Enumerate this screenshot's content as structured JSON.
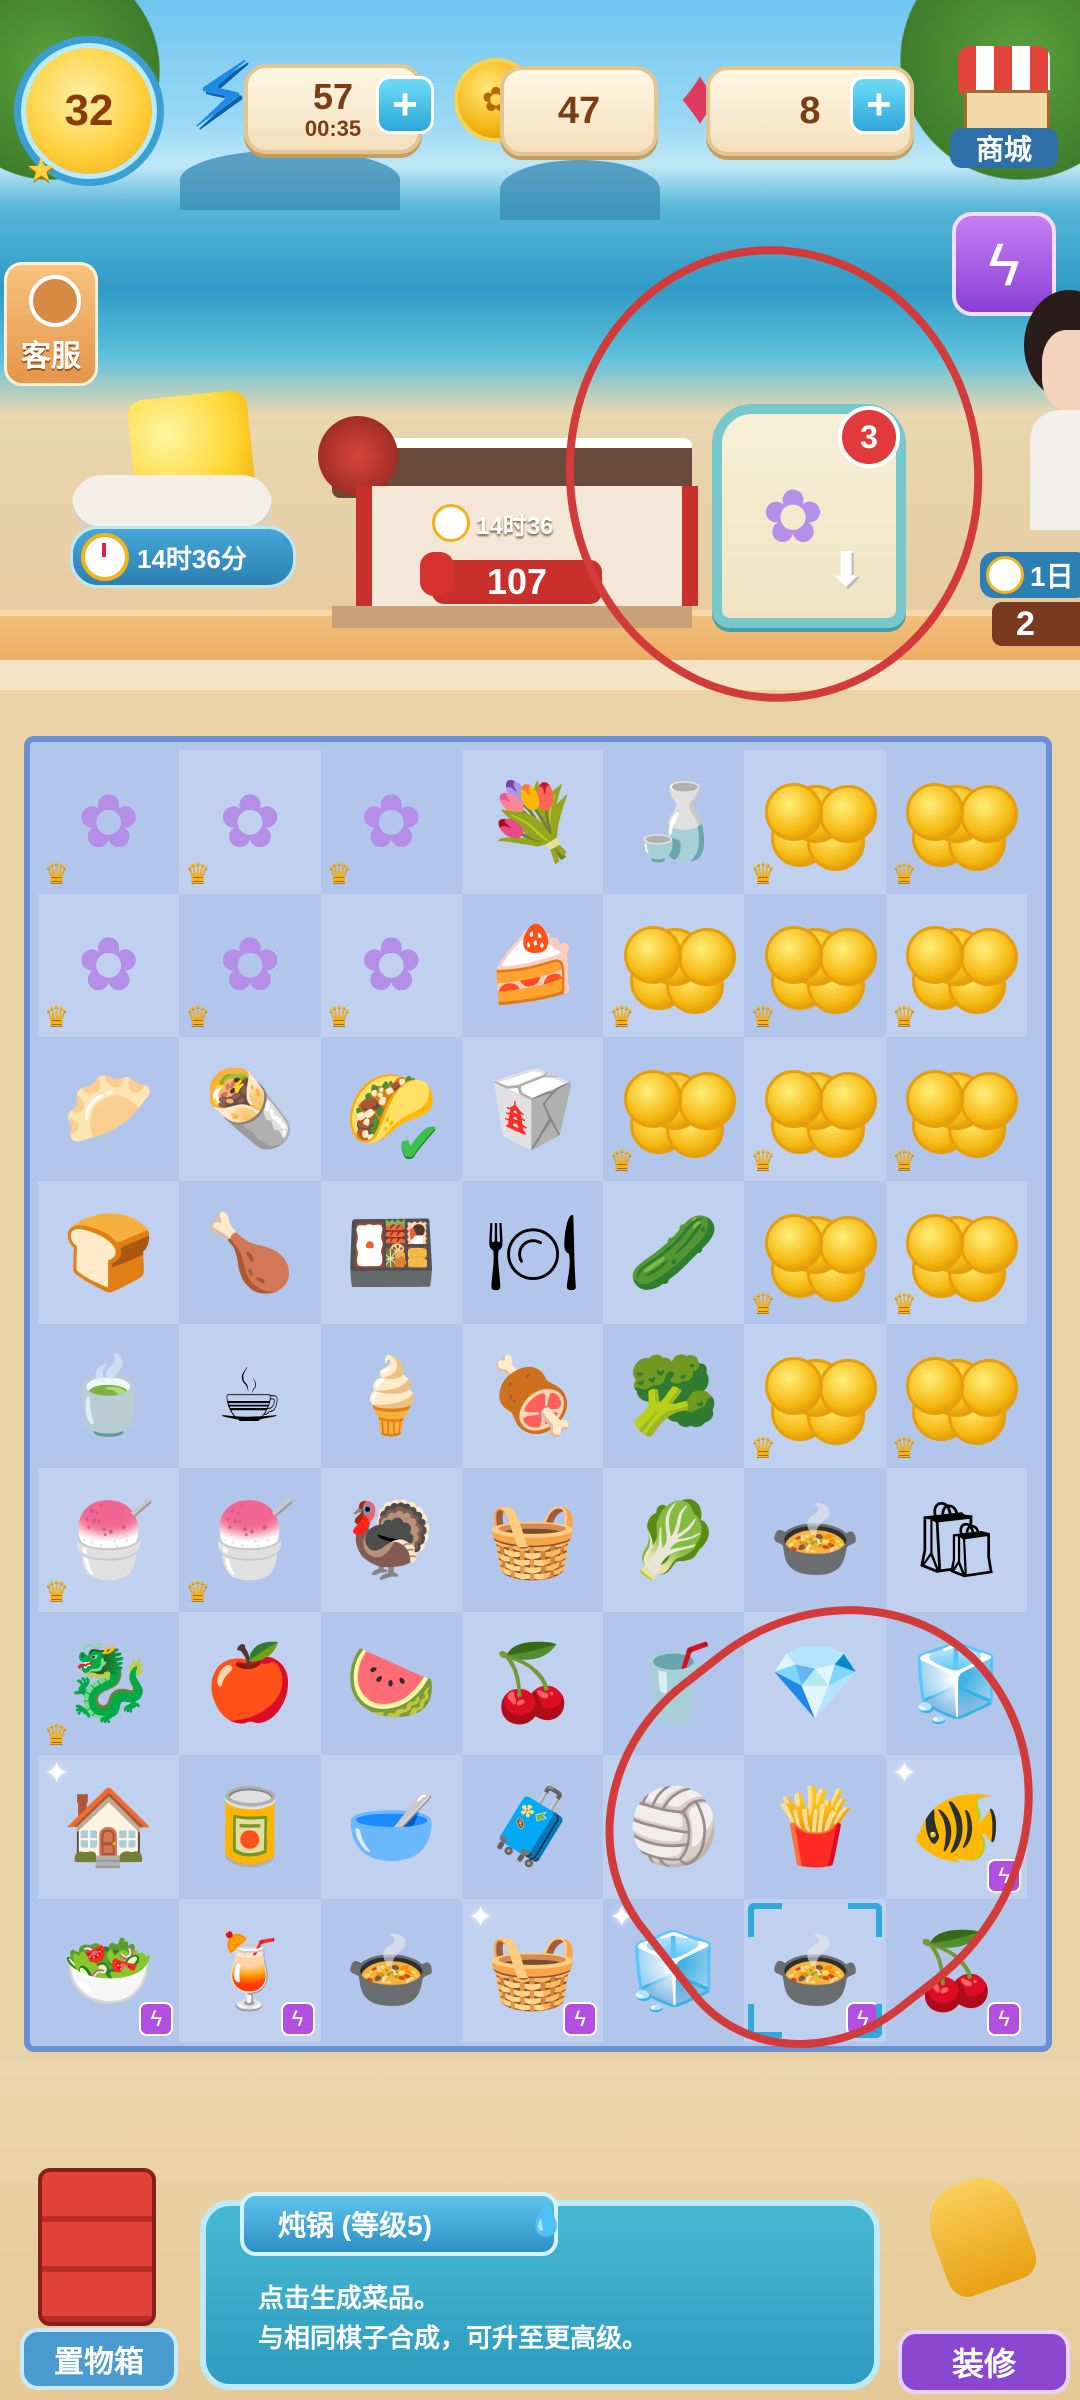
{
  "hud": {
    "level": "32",
    "energy": {
      "value": "57",
      "timer": "00:35"
    },
    "coins": {
      "value": "47"
    },
    "gems": {
      "value": "8"
    },
    "shop_label": "商城",
    "customer_service_label": "客服"
  },
  "buildings": {
    "cheese_stand_timer": "14时36分",
    "temple_timer": "14时36",
    "temple_count": "107",
    "flower_box_badge": "3",
    "right_stand_timer": "1日",
    "right_stand_count": "2"
  },
  "board": {
    "rows": [
      [
        "flower",
        "flower",
        "flower",
        "bouquet",
        "vase",
        "coins",
        "coins"
      ],
      [
        "flower",
        "flower",
        "flower",
        "cake",
        "coins",
        "coins",
        "coins"
      ],
      [
        "bun",
        "wrap",
        "taco",
        "takeout",
        "coins",
        "coins",
        "coins"
      ],
      [
        "bread",
        "duck",
        "bento",
        "tray",
        "cucumber",
        "coins",
        "coins"
      ],
      [
        "soup",
        "tea",
        "icecream",
        "roast",
        "broccoli",
        "coins",
        "coins"
      ],
      [
        "basket-bowl",
        "basket-bowl",
        "turkey",
        "picnic-basket",
        "bokchoy",
        "dumpling-bowl",
        "paper-bag"
      ],
      [
        "dragonfruit",
        "pomegranate",
        "watermelon",
        "cherries",
        "juicer",
        "crystal",
        "blue-cooler"
      ],
      [
        "dog-house",
        "pet-food",
        "pet-bowl",
        "pet-carrier",
        "beach-ball",
        "fries",
        "fishbowl"
      ],
      [
        "veg-basket",
        "blender",
        "stew-pot",
        "cherry-basket",
        "blue-cooler",
        "stew-pot",
        "cherry-bowl"
      ]
    ],
    "glyphs": {
      "flower": "✿",
      "bouquet": "💐",
      "vase": "🍶",
      "coins": "",
      "cake": "🍰",
      "bun": "🥟",
      "wrap": "🌯",
      "taco": "🌮",
      "takeout": "🥡",
      "bread": "🍞",
      "duck": "🍗",
      "bento": "🍱",
      "tray": "🍽",
      "cucumber": "🥒",
      "soup": "🍵",
      "tea": "☕",
      "icecream": "🍦",
      "roast": "🍖",
      "broccoli": "🥦",
      "basket-bowl": "🍧",
      "turkey": "🦃",
      "picnic-basket": "🧺",
      "bokchoy": "🥬",
      "dumpling-bowl": "🍲",
      "paper-bag": "🛍",
      "dragonfruit": "🐉",
      "pomegranate": "🍎",
      "watermelon": "🍉",
      "cherries": "🍒",
      "juicer": "🥤",
      "crystal": "💎",
      "blue-cooler": "🧊",
      "dog-house": "🏠",
      "pet-food": "🥫",
      "pet-bowl": "🥣",
      "pet-carrier": "🧳",
      "beach-ball": "🏐",
      "fries": "🍟",
      "fishbowl": "🐠",
      "veg-basket": "🥗",
      "blender": "🍹",
      "stew-pot": "🍲",
      "cherry-basket": "🧺",
      "cherry-bowl": "🍒"
    },
    "crowned": [
      "0-0",
      "0-1",
      "0-2",
      "0-5",
      "0-6",
      "1-0",
      "1-1",
      "1-2",
      "1-4",
      "1-5",
      "1-6",
      "2-4",
      "2-5",
      "2-6",
      "3-5",
      "3-6",
      "4-5",
      "4-6",
      "5-0",
      "5-1",
      "6-0"
    ],
    "bolted": [
      "7-6",
      "8-0",
      "8-1",
      "8-3",
      "8-5",
      "8-6"
    ],
    "checked": [
      "2-2"
    ],
    "sparkled": [
      "7-0",
      "7-6",
      "8-3",
      "8-4"
    ],
    "selected": "8-5"
  },
  "bottom": {
    "storage_label": "置物箱",
    "item_title": "炖锅 (等级5)",
    "item_desc_line1": "点击生成菜品。",
    "item_desc_line2": "与相同棋子合成，可升至更高级。",
    "decorate_label": "装修"
  },
  "colors": {
    "board_bg": "#b2c6ec",
    "board_border": "#6b8fd3",
    "annotation": "#d33a3a"
  }
}
